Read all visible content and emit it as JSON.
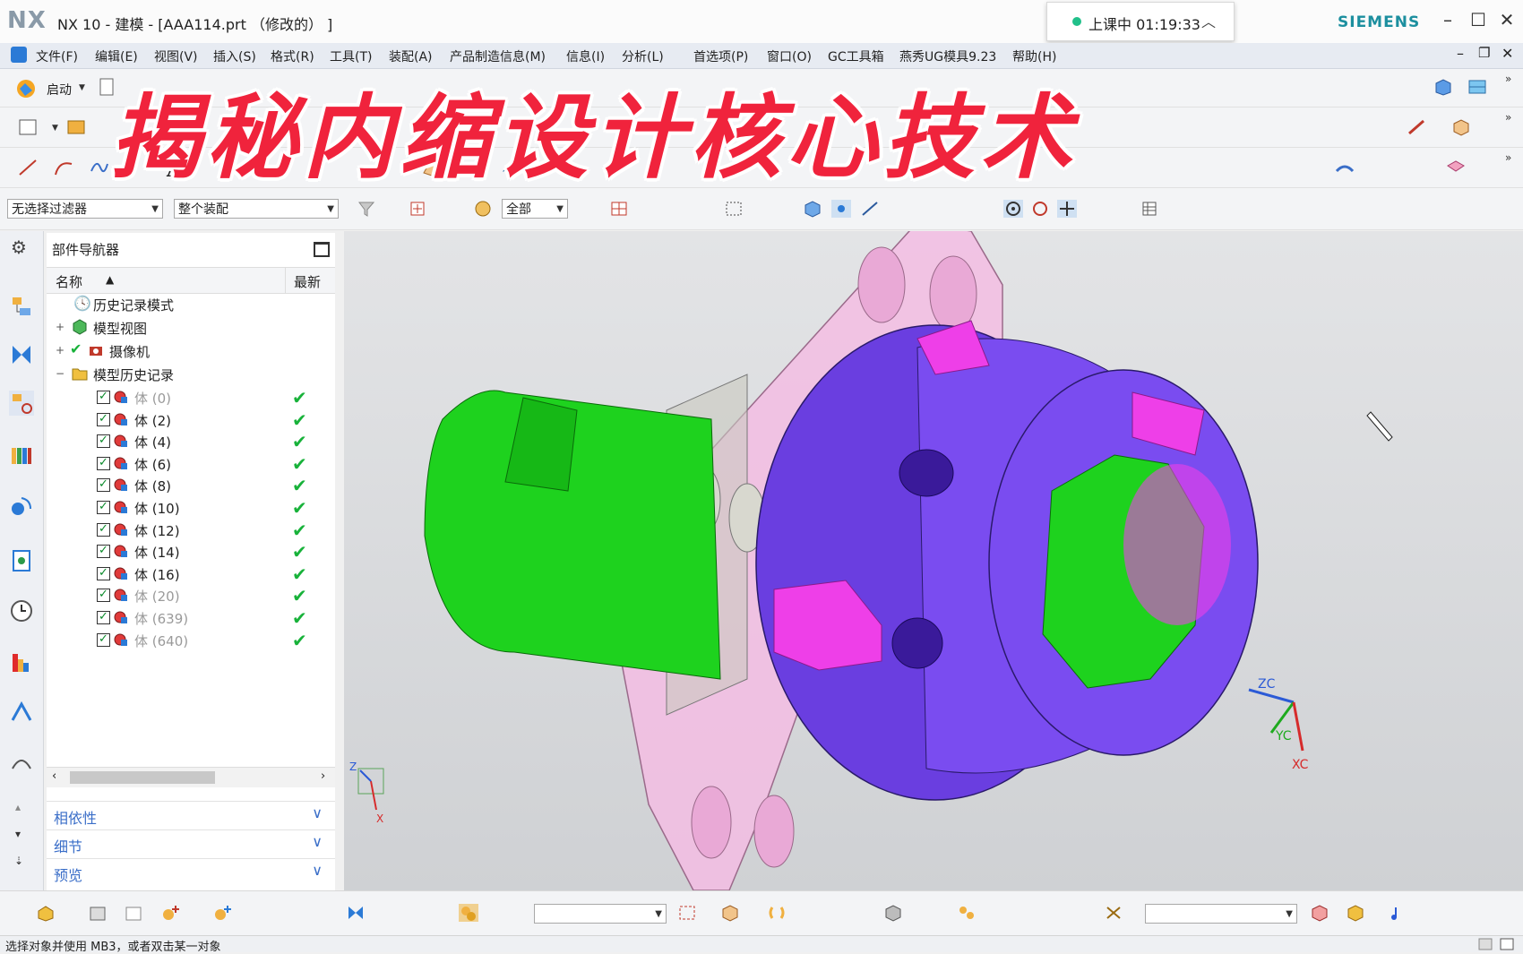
{
  "window": {
    "app_logo": "NX",
    "title": "NX 10 - 建模 - [AAA114.prt （修改的） ]",
    "brand": "SIEMENS",
    "recording": "上课中 01:19:33",
    "controls": {
      "minimize": "–",
      "maximize": "☐",
      "close": "✕"
    }
  },
  "menu": [
    {
      "label": "文件(F)"
    },
    {
      "label": "编辑(E)"
    },
    {
      "label": "视图(V)"
    },
    {
      "label": "插入(S)"
    },
    {
      "label": "格式(R)"
    },
    {
      "label": "工具(T)"
    },
    {
      "label": "装配(A)"
    },
    {
      "label": "产品制造信息(M)"
    },
    {
      "label": "信息(I)"
    },
    {
      "label": "分析(L)"
    },
    {
      "label": "首选项(P)"
    },
    {
      "label": "窗口(O)"
    },
    {
      "label": "GC工具箱"
    },
    {
      "label": "燕秀UG模具9.23"
    },
    {
      "label": "帮助(H)"
    }
  ],
  "toolbar": {
    "start_label": "启动"
  },
  "banner": "揭秘内缩设计核心技术",
  "filter": {
    "selection_filter": "无选择过滤器",
    "scope": "整个装配",
    "type": "全部"
  },
  "navigator": {
    "title": "部件导航器",
    "col_name": "名称",
    "col_latest": "最新",
    "nodes": [
      {
        "label": "历史记录模式"
      },
      {
        "label": "模型视图"
      },
      {
        "label": "摄像机"
      },
      {
        "label": "模型历史记录"
      }
    ],
    "bodies": [
      {
        "label": "体 (0)",
        "dim": true
      },
      {
        "label": "体 (2)",
        "dim": false
      },
      {
        "label": "体 (4)",
        "dim": false
      },
      {
        "label": "体 (6)",
        "dim": false
      },
      {
        "label": "体 (8)",
        "dim": false
      },
      {
        "label": "体 (10)",
        "dim": false
      },
      {
        "label": "体 (12)",
        "dim": false
      },
      {
        "label": "体 (14)",
        "dim": false
      },
      {
        "label": "体 (16)",
        "dim": false
      },
      {
        "label": "体 (20)",
        "dim": true
      },
      {
        "label": "体 (639)",
        "dim": true
      },
      {
        "label": "体 (640)",
        "dim": true
      }
    ],
    "panels": [
      {
        "label": "相依性"
      },
      {
        "label": "细节"
      },
      {
        "label": "预览"
      }
    ]
  },
  "viewport": {
    "wcs_labels": {
      "zc": "ZC",
      "yc": "YC",
      "xc": "XC"
    },
    "triad_labels": {
      "z": "Z",
      "x": "X"
    }
  },
  "status": "选择对象并使用 MB3，或者双击某一对象",
  "colors": {
    "accent": "#f0233c",
    "green_body": "#1ed21e",
    "purple_body": "#7a4cf0",
    "magenta": "#ee3fe8",
    "pink_plate": "#f3bde3"
  }
}
